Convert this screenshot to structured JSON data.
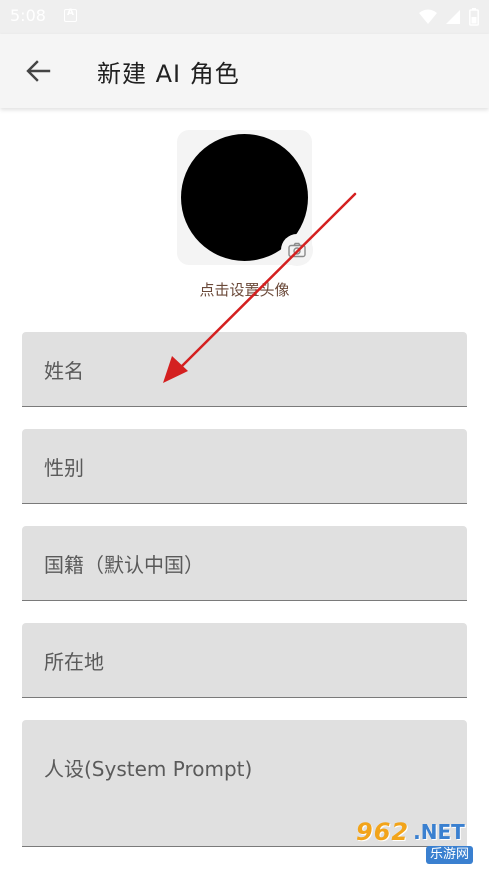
{
  "status_bar": {
    "time": "5:08",
    "notification_icon": "a-box-icon",
    "icons": [
      "wifi-icon",
      "signal-icon",
      "battery-icon"
    ]
  },
  "app_bar": {
    "back_icon": "arrow-back-icon",
    "title": "新建 AI 角色"
  },
  "avatar": {
    "caption": "点击设置头像",
    "camera_icon": "camera-icon",
    "fill_color": "#000000"
  },
  "form": {
    "fields": [
      {
        "label": "姓名"
      },
      {
        "label": "性别"
      },
      {
        "label": "国籍（默认中国）"
      },
      {
        "label": "所在地"
      },
      {
        "label": "人设(System Prompt)"
      }
    ]
  },
  "overlay": {
    "arrow_color": "#d42020"
  },
  "watermark": {
    "number": "962",
    "net": ".NET",
    "site": "乐游网"
  }
}
